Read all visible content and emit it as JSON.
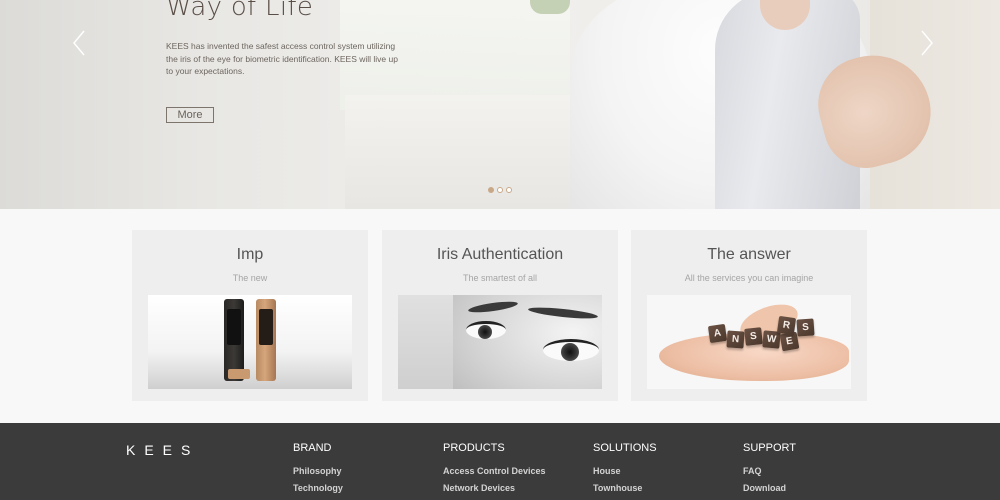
{
  "hero": {
    "title": "Way of Life",
    "description": "KEES has invented the safest access control system utilizing the iris of the eye for biometric identification. KEES will live up to your expectations.",
    "more_label": "More",
    "slide_total": 3,
    "slide_active": 1
  },
  "cards": [
    {
      "title": "Imp",
      "subtitle": "The new"
    },
    {
      "title": "Iris Authentication",
      "subtitle": "The smartest of all"
    },
    {
      "title": "The answer",
      "subtitle": "All the services you can imagine"
    }
  ],
  "answer_tiles": [
    "A",
    "N",
    "S",
    "W",
    "E",
    "R",
    "S"
  ],
  "footer": {
    "logo": "KEES",
    "columns": [
      {
        "heading": "BRAND",
        "links": [
          "Philosophy",
          "Technology"
        ]
      },
      {
        "heading": "PRODUCTS",
        "links": [
          "Access Control Devices",
          "Network Devices"
        ]
      },
      {
        "heading": "SOLUTIONS",
        "links": [
          "House",
          "Townhouse"
        ]
      },
      {
        "heading": "SUPPORT",
        "links": [
          "FAQ",
          "Download"
        ]
      }
    ]
  },
  "colors": {
    "accent": "#c9a888",
    "footer_bg": "#3b3b3b",
    "card_bg": "#eeeeee"
  }
}
